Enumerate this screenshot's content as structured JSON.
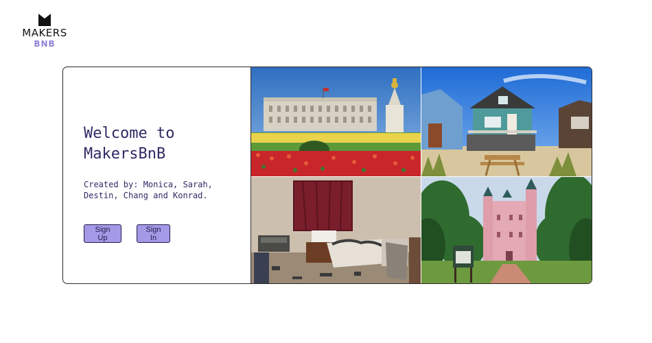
{
  "logo": {
    "line1": "MAKERS",
    "line2": "BNB",
    "icon": "crown-icon"
  },
  "hero": {
    "title": "Welcome to MakersBnB",
    "credits": "Created by: Monica, Sarah, Destin, Chang and Konrad."
  },
  "buttons": {
    "signup": "Sign Up",
    "signin": "Sign In"
  },
  "photos": [
    {
      "name": "palace-photo",
      "subject": "palace with flower garden"
    },
    {
      "name": "beach-hut-photo",
      "subject": "blue beach hut with picnic table"
    },
    {
      "name": "messy-room-photo",
      "subject": "cluttered bedroom"
    },
    {
      "name": "pink-castle-photo",
      "subject": "pink castle among trees"
    }
  ],
  "colors": {
    "accent": "#a399e6",
    "text": "#2e2a63",
    "logo_bnb": "#8f84d6"
  }
}
